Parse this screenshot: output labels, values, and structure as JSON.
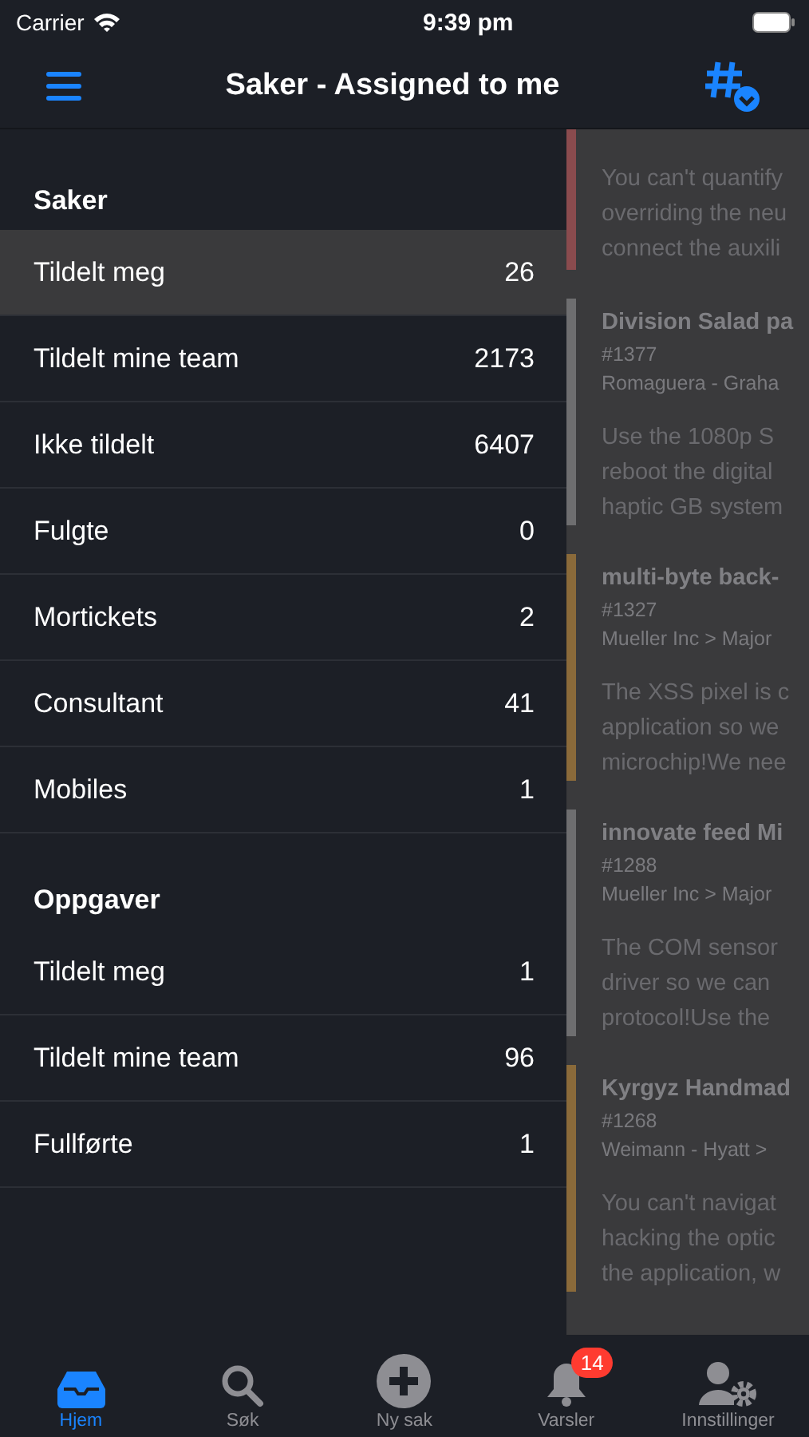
{
  "status_bar": {
    "carrier": "Carrier",
    "time": "9:39 pm"
  },
  "nav": {
    "title": "Saker - Assigned to me"
  },
  "sections": [
    {
      "title": "Saker",
      "items": [
        {
          "label": "Tildelt meg",
          "count": "26",
          "selected": true
        },
        {
          "label": "Tildelt mine team",
          "count": "2173",
          "selected": false
        },
        {
          "label": "Ikke tildelt",
          "count": "6407",
          "selected": false
        },
        {
          "label": "Fulgte",
          "count": "0",
          "selected": false
        },
        {
          "label": "Mortickets",
          "count": "2",
          "selected": false
        },
        {
          "label": "Consultant",
          "count": "41",
          "selected": false
        },
        {
          "label": "Mobiles",
          "count": "1",
          "selected": false
        }
      ]
    },
    {
      "title": "Oppgaver",
      "items": [
        {
          "label": "Tildelt meg",
          "count": "1",
          "selected": false
        },
        {
          "label": "Tildelt mine team",
          "count": "96",
          "selected": false
        },
        {
          "label": "Fullførte",
          "count": "1",
          "selected": false
        }
      ]
    }
  ],
  "tickets": [
    {
      "color": "#8a4b4e",
      "lines": [
        "You can't quantify",
        "overriding the neu",
        "connect the auxili"
      ]
    },
    {
      "color": "#6e6e70",
      "title": "Division Salad pa",
      "number": "#1377",
      "path": "Romaguera - Graha",
      "lines": [
        "Use the 1080p S",
        "reboot the digital",
        "haptic GB system"
      ]
    },
    {
      "color": "#8a6a3a",
      "title": "multi-byte back-",
      "number": "#1327",
      "path": "Mueller Inc > Major",
      "lines": [
        "The XSS pixel is c",
        "application so we",
        "microchip!We nee"
      ]
    },
    {
      "color": "#6e6e70",
      "title": "innovate feed Mi",
      "number": "#1288",
      "path": "Mueller Inc > Major",
      "lines": [
        "The COM sensor",
        "driver so we can",
        "protocol!Use the"
      ]
    },
    {
      "color": "#8a6a3a",
      "title": "Kyrgyz Handmad",
      "number": "#1268",
      "path": "Weimann - Hyatt >",
      "lines": [
        "You can't navigat",
        "hacking the optic",
        "the application, w"
      ]
    }
  ],
  "tab_bar": [
    {
      "kind": "inbox",
      "label": "Hjem",
      "selected": true
    },
    {
      "kind": "search",
      "label": "Søk",
      "selected": false
    },
    {
      "kind": "plus",
      "label": "Ny sak",
      "selected": false
    },
    {
      "kind": "bell",
      "label": "Varsler",
      "selected": false,
      "badge": "14"
    },
    {
      "kind": "settings",
      "label": "Innstillinger",
      "selected": false
    }
  ]
}
